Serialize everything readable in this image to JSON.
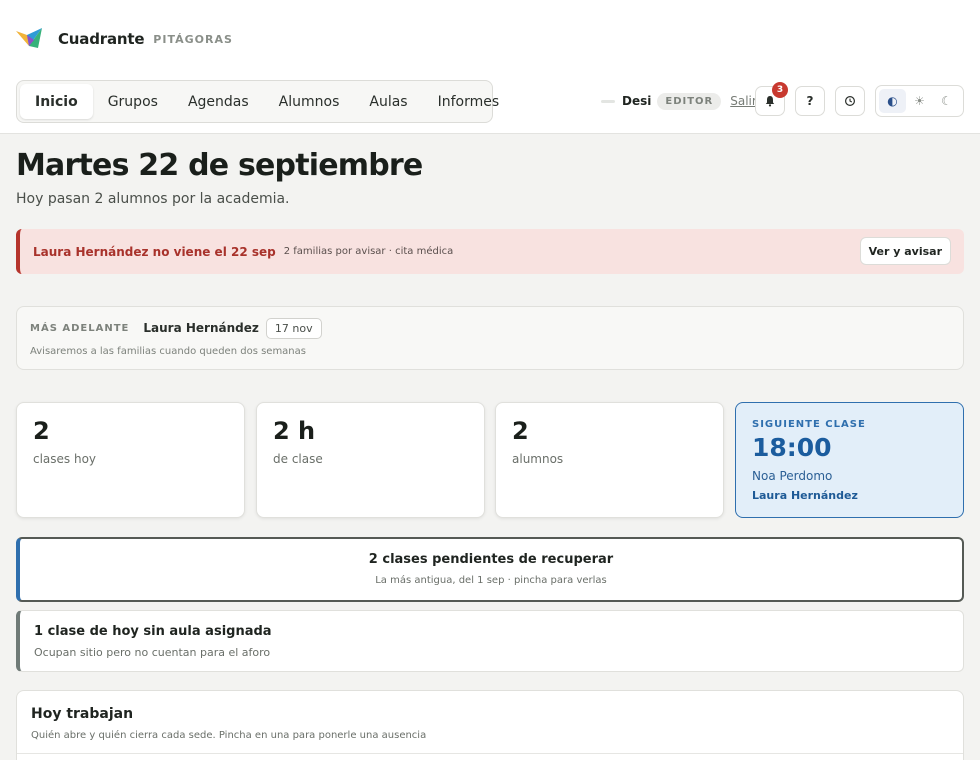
{
  "brand": {
    "name": "Cuadrante",
    "sub": "PITÁGORAS"
  },
  "nav": {
    "items": [
      {
        "label": "Inicio",
        "active": true
      },
      {
        "label": "Grupos"
      },
      {
        "label": "Agendas"
      },
      {
        "label": "Alumnos"
      },
      {
        "label": "Aulas"
      },
      {
        "label": "Informes"
      }
    ]
  },
  "user": {
    "name": "Desi",
    "role": "EDITOR",
    "logout_label": "Salir"
  },
  "toolbar": {
    "notifications_count": "3",
    "help_label": "?",
    "icons": [
      "bell-icon",
      "help-icon",
      "clock-icon"
    ]
  },
  "theme": {
    "options": [
      "contrast-icon",
      "sun-icon",
      "moon-icon"
    ],
    "selected": "contrast-icon"
  },
  "page": {
    "title": "Martes 22 de septiembre",
    "subtitle": "Hoy pasan 2 alumnos por la academia."
  },
  "alert": {
    "title": "Laura Hernández no viene el 22 sep",
    "meta": "2 familias por avisar · cita médica",
    "button": "Ver y avisar",
    "color": "#b5342c"
  },
  "upcoming": {
    "label": "MÁS ADELANTE",
    "name": "Laura Hernández",
    "date": "17 nov",
    "note": "Avisaremos a las familias cuando queden dos semanas"
  },
  "stats": [
    {
      "value": "2",
      "label": "clases hoy"
    },
    {
      "value": "2 h",
      "label": "de clase"
    },
    {
      "value": "2",
      "label": "alumnos"
    }
  ],
  "next_class": {
    "label": "SIGUIENTE CLASE",
    "time": "18:00",
    "group": "Noa Perdomo",
    "teacher": "Laura Hernández",
    "accent": "#2f6fae"
  },
  "pending": {
    "title": "2 clases pendientes de recuperar",
    "subtitle": "La más antigua, del 1 sep · pincha para verlas"
  },
  "no_room": {
    "title": "1 clase de hoy sin aula asignada",
    "subtitle": "Ocupan sitio pero no cuentan para el aforo"
  },
  "working_today": {
    "title": "Hoy trabajan",
    "subtitle": "Quién abre y quién cierra cada sede. Pincha en una para ponerle una ausencia"
  }
}
